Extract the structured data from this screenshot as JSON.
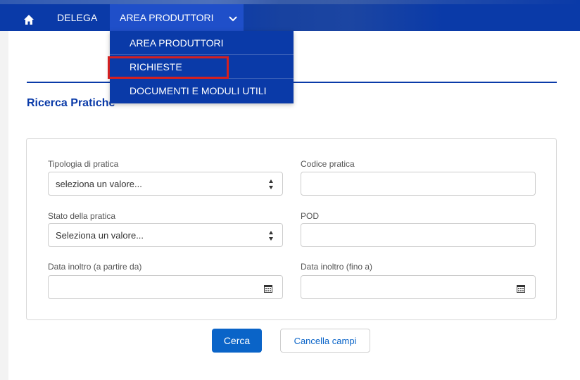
{
  "nav": {
    "home_icon": "home-icon",
    "delega": "DELEGA",
    "area_produttori": "AREA PRODUTTORI",
    "chevron_icon": "chevron-down-icon",
    "bar_color": "#0a3aa8"
  },
  "dropdown": {
    "items": [
      {
        "label": "AREA PRODUTTORI"
      },
      {
        "label": "RICHIESTE"
      },
      {
        "label": "DOCUMENTI E MODULI UTILI"
      }
    ]
  },
  "page": {
    "title": "Ricerca Pratiche"
  },
  "form": {
    "tipologia": {
      "label": "Tipologia di pratica",
      "value": "seleziona un valore..."
    },
    "codice": {
      "label": "Codice pratica",
      "value": ""
    },
    "stato": {
      "label": "Stato della pratica",
      "value": "Seleziona un valore..."
    },
    "pod": {
      "label": "POD",
      "value": ""
    },
    "data_da": {
      "label": "Data inoltro (a partire da)",
      "value": ""
    },
    "data_a": {
      "label": "Data inoltro (fino a)",
      "value": ""
    }
  },
  "buttons": {
    "cerca": "Cerca",
    "cancella": "Cancella campi",
    "primary_color": "#0a64c8"
  }
}
